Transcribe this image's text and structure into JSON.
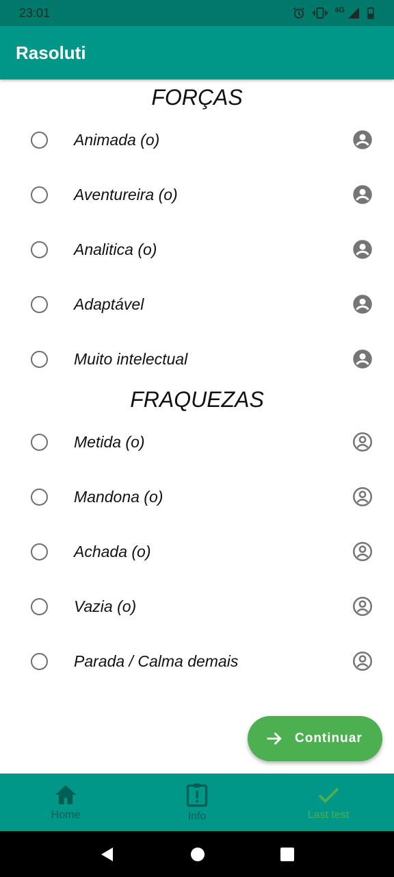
{
  "status_bar": {
    "time": "23:01",
    "network": "4G"
  },
  "app_bar": {
    "title": "Rasoluti"
  },
  "sections": {
    "strengths": {
      "title": "FORÇAS",
      "items": [
        "Animada (o)",
        "Aventureira (o)",
        "Analitica (o)",
        "Adaptável",
        "Muito intelectual"
      ],
      "icon": "account-circle-icon"
    },
    "weaknesses": {
      "title": "FRAQUEZAS",
      "items": [
        "Metida (o)",
        "Mandona (o)",
        "Achada (o)",
        "Vazia (o)",
        "Parada / Calma demais"
      ],
      "icon": "account-circle-outline-icon"
    }
  },
  "fab": {
    "label": "Continuar",
    "icon": "arrow-right-icon"
  },
  "bottom_nav": {
    "items": [
      {
        "label": "Home",
        "icon": "home-icon"
      },
      {
        "label": "Info",
        "icon": "clipboard-alert-icon"
      },
      {
        "label": "Last test",
        "icon": "check-icon"
      }
    ],
    "active_index": 2
  },
  "colors": {
    "primary": "#009688",
    "primary_dark": "#00796b",
    "accent": "#4caf50",
    "inactive_nav": "#005e54"
  }
}
